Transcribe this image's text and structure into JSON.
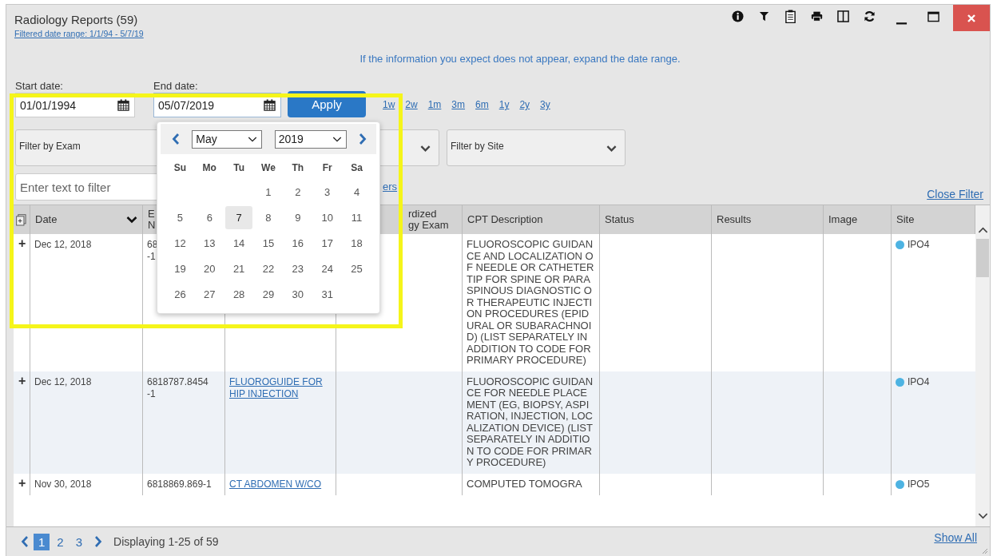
{
  "window": {
    "title": "Radiology Reports (59)",
    "filter_summary": "Filtered date range: 1/1/94 - 5/7/19"
  },
  "notice": "If the information you expect does not appear, expand the date range.",
  "date_filter": {
    "start_label": "Start date:",
    "start_value": "01/01/1994",
    "end_label": "End date:",
    "end_value": "05/07/2019",
    "apply": "Apply",
    "ranges": [
      "1w",
      "2w",
      "1m",
      "3m",
      "6m",
      "1y",
      "2y",
      "3y"
    ]
  },
  "calendar": {
    "month": "May",
    "year": "2019",
    "weekdays": [
      "Su",
      "Mo",
      "Tu",
      "We",
      "Th",
      "Fr",
      "Sa"
    ],
    "weeks": [
      [
        {
          "label": "1",
          "selected": false
        },
        {
          "label": "2",
          "selected": false
        },
        {
          "label": "3",
          "selected": false
        },
        {
          "label": "4",
          "selected": false
        }
      ],
      [
        {
          "label": "5",
          "selected": false
        },
        {
          "label": "6",
          "selected": false
        },
        {
          "label": "7",
          "selected": true
        },
        {
          "label": "8",
          "selected": false
        },
        {
          "label": "9",
          "selected": false
        },
        {
          "label": "10",
          "selected": false
        },
        {
          "label": "11",
          "selected": false
        }
      ],
      [
        {
          "label": "12",
          "selected": false
        },
        {
          "label": "13",
          "selected": false
        },
        {
          "label": "14",
          "selected": false
        },
        {
          "label": "15",
          "selected": false
        },
        {
          "label": "16",
          "selected": false
        },
        {
          "label": "17",
          "selected": false
        },
        {
          "label": "18",
          "selected": false
        }
      ],
      [
        {
          "label": "19",
          "selected": false
        },
        {
          "label": "20",
          "selected": false
        },
        {
          "label": "21",
          "selected": false
        },
        {
          "label": "22",
          "selected": false
        },
        {
          "label": "23",
          "selected": false
        },
        {
          "label": "24",
          "selected": false
        },
        {
          "label": "25",
          "selected": false
        }
      ],
      [
        {
          "label": "26",
          "selected": false
        },
        {
          "label": "27",
          "selected": false
        },
        {
          "label": "28",
          "selected": false
        },
        {
          "label": "29",
          "selected": false
        },
        {
          "label": "30",
          "selected": false
        },
        {
          "label": "31",
          "selected": false
        }
      ]
    ]
  },
  "filters": {
    "exam_label": "Filter by Exam",
    "site_label": "Filter by Site",
    "text_placeholder": "Enter text to filter",
    "link_fragment": "ers",
    "close": "Close Filter"
  },
  "table": {
    "columns": [
      {
        "label": "Date",
        "sortable": true
      },
      {
        "label": "E\nN"
      },
      {},
      {
        "label": "rdized\ngy Exam",
        "sortable": false
      },
      {
        "label": "CPT Description",
        "sortable": false
      },
      {
        "label": "Status",
        "sortable": false
      },
      {
        "label": "Results",
        "sortable": false
      },
      {
        "label": "Image",
        "sortable": false
      },
      {
        "label": "Site",
        "sortable": false
      }
    ],
    "rows": [
      {
        "expander": "+",
        "date": "Dec 12, 2018",
        "exam_number": "68\n-1",
        "cpt": "FLUOROSCOPIC GUIDANCE AND LOCALIZATION OF NEEDLE OR CATHETER TIP FOR SPINE OR PARASPINOUS DIAGNOSTIC OR THERAPEUTIC INJECTION PROCEDURES (EPIDURAL OR SUBARACHNOID) (LIST SEPARATELY IN ADDITION TO CODE FOR PRIMARY PROCEDURE)",
        "site": {
          "label": "IPO4",
          "color": "#4db3e2"
        }
      },
      {
        "expander": "+",
        "date": "Dec 12, 2018",
        "exam_number": "6818787.8454\n-1",
        "exam_name": "FLUOROGUIDE FOR HIP INJECTION",
        "cpt": "FLUOROSCOPIC GUIDANCE FOR NEEDLE PLACEMENT (EG, BIOPSY, ASPIRATION, INJECTION, LOCALIZATION DEVICE) (LIST SEPARATELY IN ADDITION TO CODE FOR PRIMARY PROCEDURE)",
        "site": {
          "label": "IPO4",
          "color": "#4db3e2"
        }
      },
      {
        "expander": "+",
        "date": "Nov 30, 2018",
        "exam_number": "6818869.869-1",
        "exam_name": "CT ABDOMEN W/CO",
        "cpt": "COMPUTED TOMOGRA",
        "site": {
          "label": "IPO5",
          "color": "#4db3e2"
        }
      }
    ]
  },
  "pager": {
    "pages": [
      {
        "label": "1",
        "selected": true
      },
      {
        "label": "2",
        "selected": false
      },
      {
        "label": "3",
        "selected": false
      }
    ],
    "summary": "Displaying 1-25 of 59",
    "show_all": "Show All"
  }
}
